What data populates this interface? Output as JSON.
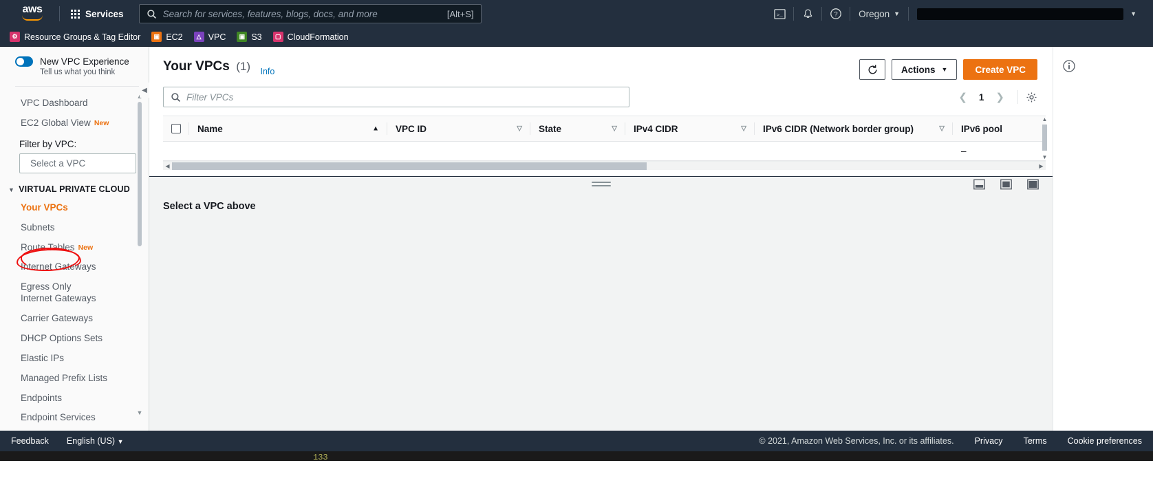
{
  "topnav": {
    "logo_text": "aws",
    "services_label": "Services",
    "search_placeholder": "Search for services, features, blogs, docs, and more",
    "search_value": "",
    "search_shortcut": "[Alt+S]",
    "cloudshell_icon": "cloudshell-icon",
    "notifications_icon": "bell-icon",
    "help_icon": "help-circle-icon",
    "region": "Oregon",
    "account_label": ""
  },
  "favorites": [
    {
      "label": "Resource Groups & Tag Editor",
      "color": "#d13212",
      "glyph": "⚙"
    },
    {
      "label": "EC2",
      "color": "#ec7211",
      "glyph": "☁"
    },
    {
      "label": "VPC",
      "color": "#7b42bc",
      "glyph": "☁"
    },
    {
      "label": "S3",
      "color": "#3f8624",
      "glyph": "▣"
    },
    {
      "label": "CloudFormation",
      "color": "#d6336c",
      "glyph": "▤"
    }
  ],
  "sidebar": {
    "new_experience_title": "New VPC Experience",
    "new_experience_sub": "Tell us what you think",
    "dashboard": "VPC Dashboard",
    "global_view": "EC2 Global View",
    "global_view_badge": "New",
    "filter_label": "Filter by VPC:",
    "filter_placeholder": "Select a VPC",
    "filter_value": "",
    "section_title": "VIRTUAL PRIVATE CLOUD",
    "items": [
      {
        "label": "Your VPCs",
        "badge": "",
        "active": true
      },
      {
        "label": "Subnets",
        "badge": "",
        "active": false
      },
      {
        "label": "Route Tables",
        "badge": "New",
        "active": false
      },
      {
        "label": "Internet Gateways",
        "badge": "",
        "active": false
      },
      {
        "label": "Egress Only Internet Gateways",
        "badge": "",
        "active": false
      },
      {
        "label": "Carrier Gateways",
        "badge": "",
        "active": false
      },
      {
        "label": "DHCP Options Sets",
        "badge": "",
        "active": false
      },
      {
        "label": "Elastic IPs",
        "badge": "",
        "active": false
      },
      {
        "label": "Managed Prefix Lists",
        "badge": "",
        "active": false
      },
      {
        "label": "Endpoints",
        "badge": "",
        "active": false
      },
      {
        "label": "Endpoint Services",
        "badge": "",
        "active": false
      }
    ]
  },
  "main": {
    "title": "Your VPCs",
    "count": "(1)",
    "info_label": "Info",
    "refresh_icon": "refresh-icon",
    "actions_label": "Actions",
    "create_label": "Create VPC",
    "filter_placeholder": "Filter VPCs",
    "filter_value": "",
    "page_number": "1",
    "settings_icon": "gear-icon",
    "table": {
      "columns": [
        {
          "label": "Name",
          "sort": "asc"
        },
        {
          "label": "VPC ID",
          "sort": "none"
        },
        {
          "label": "State",
          "sort": "none"
        },
        {
          "label": "IPv4 CIDR",
          "sort": "none"
        },
        {
          "label": "IPv6 CIDR (Network border group)",
          "sort": "none"
        },
        {
          "label": "IPv6 pool",
          "sort": "none"
        }
      ],
      "rows": [
        {
          "name": "",
          "vpc_id": "",
          "state": "",
          "ipv4_cidr": "",
          "ipv6_cidr": "",
          "ipv6_pool": "–"
        }
      ]
    },
    "detail_message": "Select a VPC above"
  },
  "footer": {
    "feedback": "Feedback",
    "language": "English (US)",
    "copyright": "© 2021, Amazon Web Services, Inc. or its affiliates.",
    "privacy": "Privacy",
    "terms": "Terms",
    "cookies": "Cookie preferences"
  },
  "colors": {
    "aws_navy": "#232f3e",
    "aws_orange": "#ec7211",
    "link_blue": "#0073bb",
    "annotation_red": "#ee1111"
  }
}
